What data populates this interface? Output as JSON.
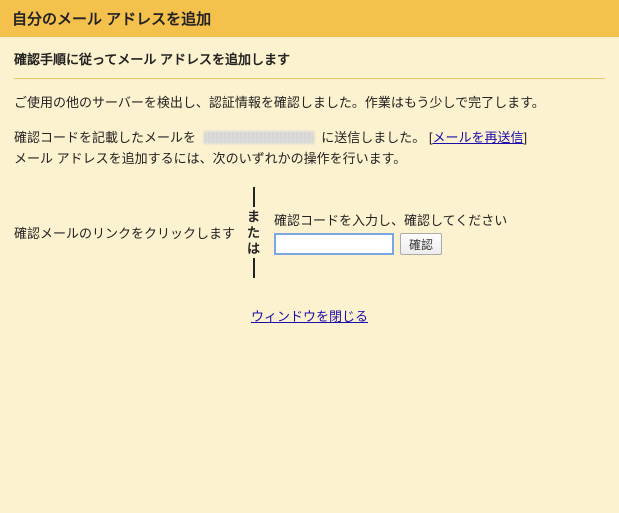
{
  "header": {
    "title": "自分のメール アドレスを追加"
  },
  "subheading": "確認手順に従ってメール アドレスを追加します",
  "body": {
    "line1": "ご使用の他のサーバーを検出し、認証情報を確認しました。作業はもう少しで完了します。",
    "line2_prefix": "確認コードを記載したメールを",
    "line2_suffix_before_link": "に送信しました。 [",
    "resend_link": "メールを再送信",
    "line2_suffix_after_link": "]",
    "line3": "メール アドレスを追加するには、次のいずれかの操作を行います。"
  },
  "verify": {
    "left_text": "確認メールのリンクをクリックします",
    "or_text": "または",
    "right_label": "確認コードを入力し、確認してください",
    "input_value": "",
    "confirm_button": "確認"
  },
  "close_link": "ウィンドウを閉じる"
}
